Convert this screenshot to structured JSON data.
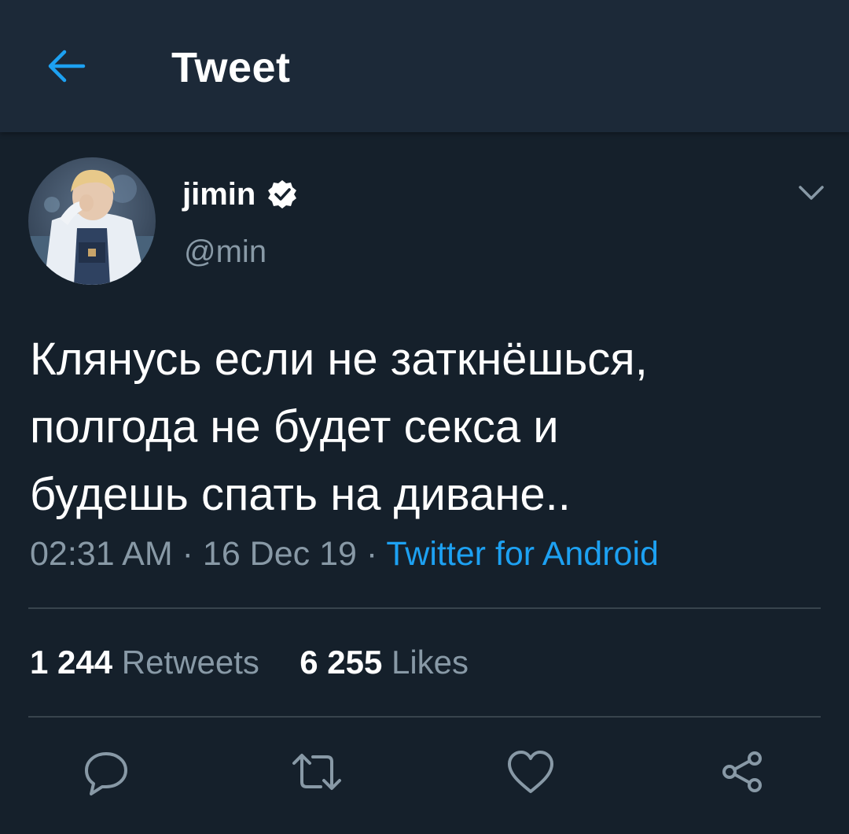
{
  "header": {
    "title": "Tweet",
    "back_icon": "arrow-left-icon"
  },
  "author": {
    "display_name": "jimin",
    "handle": "@min",
    "verified": true
  },
  "tweet": {
    "text": "Клянусь если не заткнёшься,\nполгода не будет секса и\nбудешь спать на диване..",
    "time": "02:31 AM",
    "date": "16 Dec 19",
    "separator": " · ",
    "source": "Twitter for Android"
  },
  "stats": {
    "retweets_count": "1 244",
    "retweets_label": "Retweets",
    "likes_count": "6 255",
    "likes_label": "Likes"
  },
  "actions": [
    "reply-icon",
    "retweet-icon",
    "like-icon",
    "share-icon"
  ],
  "colors": {
    "background": "#15202b",
    "header": "#1c2938",
    "accent": "#1da1f2",
    "secondary_text": "#8899a6",
    "divider": "#38444d"
  }
}
